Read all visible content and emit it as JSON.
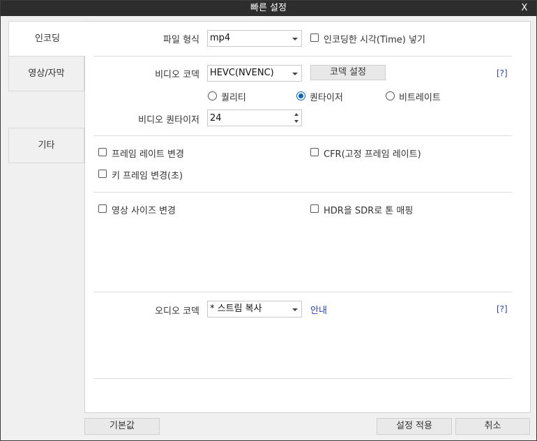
{
  "window": {
    "title": "빠른 설정",
    "close_label": "X"
  },
  "sidebar": {
    "items": [
      {
        "label": "인코딩"
      },
      {
        "label": "영상/자막"
      },
      {
        "label": "기타"
      }
    ]
  },
  "encoding": {
    "file_format_label": "파일 형식",
    "file_format_value": "mp4",
    "encode_time_label": "인코딩한 시각(Time) 넣기",
    "video_codec_label": "비디오 코덱",
    "video_codec_value": "HEVC(NVENC)",
    "codec_settings_label": "코덱 설정",
    "help_label": "[?]",
    "rate_options": [
      {
        "label": "퀄리티"
      },
      {
        "label": "퀀타이저"
      },
      {
        "label": "비트레이트"
      }
    ],
    "rate_selected": "퀀타이저",
    "quantizer_label": "비디오 퀀타이저",
    "quantizer_value": "24",
    "frame_rate_change_label": "프레임 레이트 변경",
    "cfr_label": "CFR(고정 프레임 레이트)",
    "key_frame_label": "키 프레임 변경(초)",
    "resize_label": "영상 사이즈 변경",
    "hdr_label": "HDR을 SDR로 톤 매핑",
    "audio_codec_label": "오디오 코덱",
    "audio_codec_value": "* 스트림 복사",
    "guide_label": "안내",
    "audio_help_label": "[?]"
  },
  "footer": {
    "default_label": "기본값",
    "apply_label": "설정 적용",
    "cancel_label": "취소"
  },
  "colors": {
    "titlebar": "#2d2d2d",
    "link": "#2c3fbf",
    "radio_selected": "#0a64c8"
  }
}
